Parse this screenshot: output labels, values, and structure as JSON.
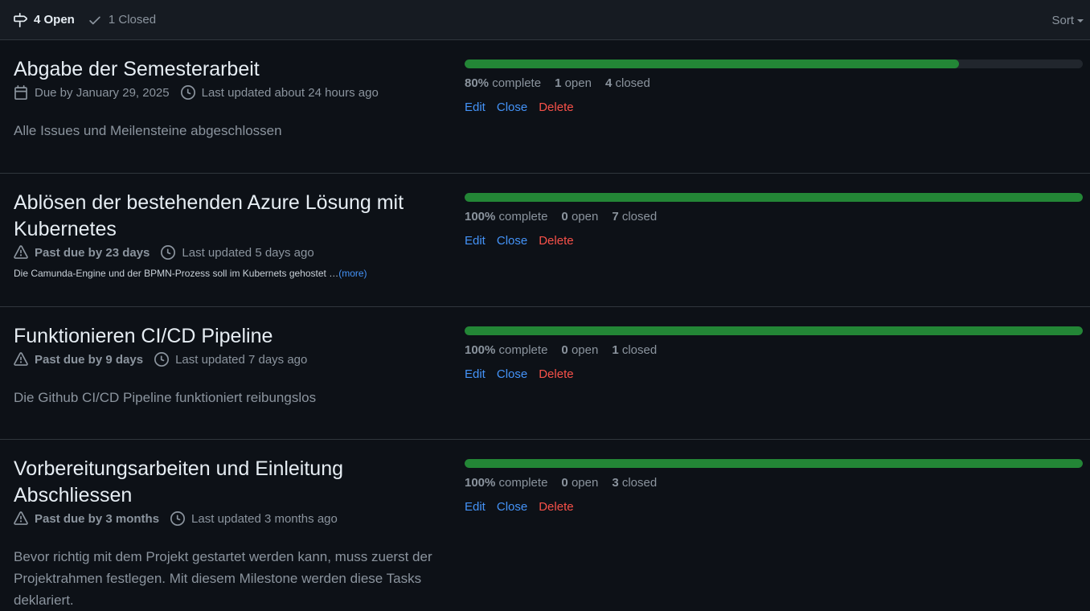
{
  "header": {
    "open_label": "4 Open",
    "closed_label": "1 Closed",
    "sort_label": "Sort"
  },
  "milestones": [
    {
      "title": "Abgabe der Semesterarbeit",
      "due_text": "Due by January 29, 2025",
      "due_icon": "calendar-icon",
      "updated": "Last updated about 24 hours ago",
      "description": "Alle Issues und Meilensteine abgeschlossen",
      "progress_percent": 80,
      "percent_label": "80%",
      "open_count": "1",
      "closed_count": "4"
    },
    {
      "title": "Ablösen der bestehenden Azure Lösung mit Kubernetes",
      "due_text": "Past due by 23 days",
      "due_icon": "alert-icon",
      "updated": "Last updated 5 days ago",
      "description": "Die Camunda-Engine und der BPMN-Prozess soll im Kubernets gehostet …",
      "more_label": "(more)",
      "progress_percent": 100,
      "percent_label": "100%",
      "open_count": "0",
      "closed_count": "7"
    },
    {
      "title": "Funktionieren CI/CD Pipeline",
      "due_text": "Past due by 9 days",
      "due_icon": "alert-icon",
      "updated": "Last updated 7 days ago",
      "description": "Die Github CI/CD Pipeline funktioniert reibungslos",
      "progress_percent": 100,
      "percent_label": "100%",
      "open_count": "0",
      "closed_count": "1"
    },
    {
      "title": "Vorbereitungsarbeiten und Einleitung Abschliessen",
      "due_text": "Past due by 3 months",
      "due_icon": "alert-icon",
      "updated": "Last updated 3 months ago",
      "description": "Bevor richtig mit dem Projekt gestartet werden kann, muss zuerst der Projektrahmen festlegen. Mit diesem Milestone werden diese Tasks deklariert.",
      "progress_percent": 100,
      "percent_label": "100%",
      "open_count": "0",
      "closed_count": "3"
    }
  ],
  "labels": {
    "complete": "complete",
    "open": "open",
    "closed": "closed",
    "edit": "Edit",
    "close": "Close",
    "delete": "Delete"
  },
  "colors": {
    "background": "#0d1117",
    "header_bg": "#161b22",
    "progress_fill": "#238636",
    "progress_track": "#21262d",
    "link": "#4493f8",
    "danger": "#f85149",
    "muted": "#8b949e"
  }
}
